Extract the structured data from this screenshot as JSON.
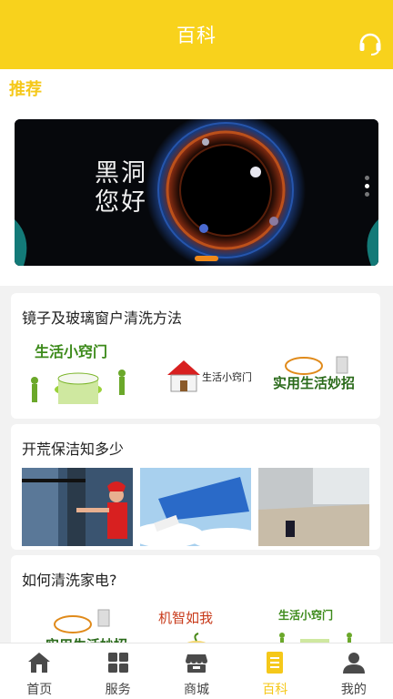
{
  "header": {
    "title": "百科",
    "support_icon": "headset-icon",
    "background": "#f8d21c"
  },
  "recommend": {
    "label": "推荐",
    "banner": {
      "headline_line1": "黑洞",
      "headline_line2": "您好",
      "dots_count": 3,
      "active_dot": 1
    }
  },
  "articles": [
    {
      "title": "镜子及玻璃窗户清洗方法",
      "thumbs": [
        {
          "caption": "生活小窍门"
        },
        {
          "caption": "生活小窍门"
        },
        {
          "caption": "实用生活妙招"
        }
      ]
    },
    {
      "title": "开荒保洁知多少",
      "thumbs": [
        {
          "caption": ""
        },
        {
          "caption": ""
        },
        {
          "caption": ""
        }
      ]
    },
    {
      "title": "如何清洗家电?",
      "thumbs": [
        {
          "caption": "实用生活妙招"
        },
        {
          "caption": "机智如我"
        },
        {
          "caption": "生活小窍门"
        }
      ]
    }
  ],
  "tabbar": {
    "items": [
      {
        "label": "首页",
        "icon": "home-icon"
      },
      {
        "label": "服务",
        "icon": "grid-icon"
      },
      {
        "label": "商城",
        "icon": "store-icon"
      },
      {
        "label": "百科",
        "icon": "book-icon",
        "active": true
      },
      {
        "label": "我的",
        "icon": "user-icon"
      }
    ],
    "active_color": "#f5c81a"
  }
}
